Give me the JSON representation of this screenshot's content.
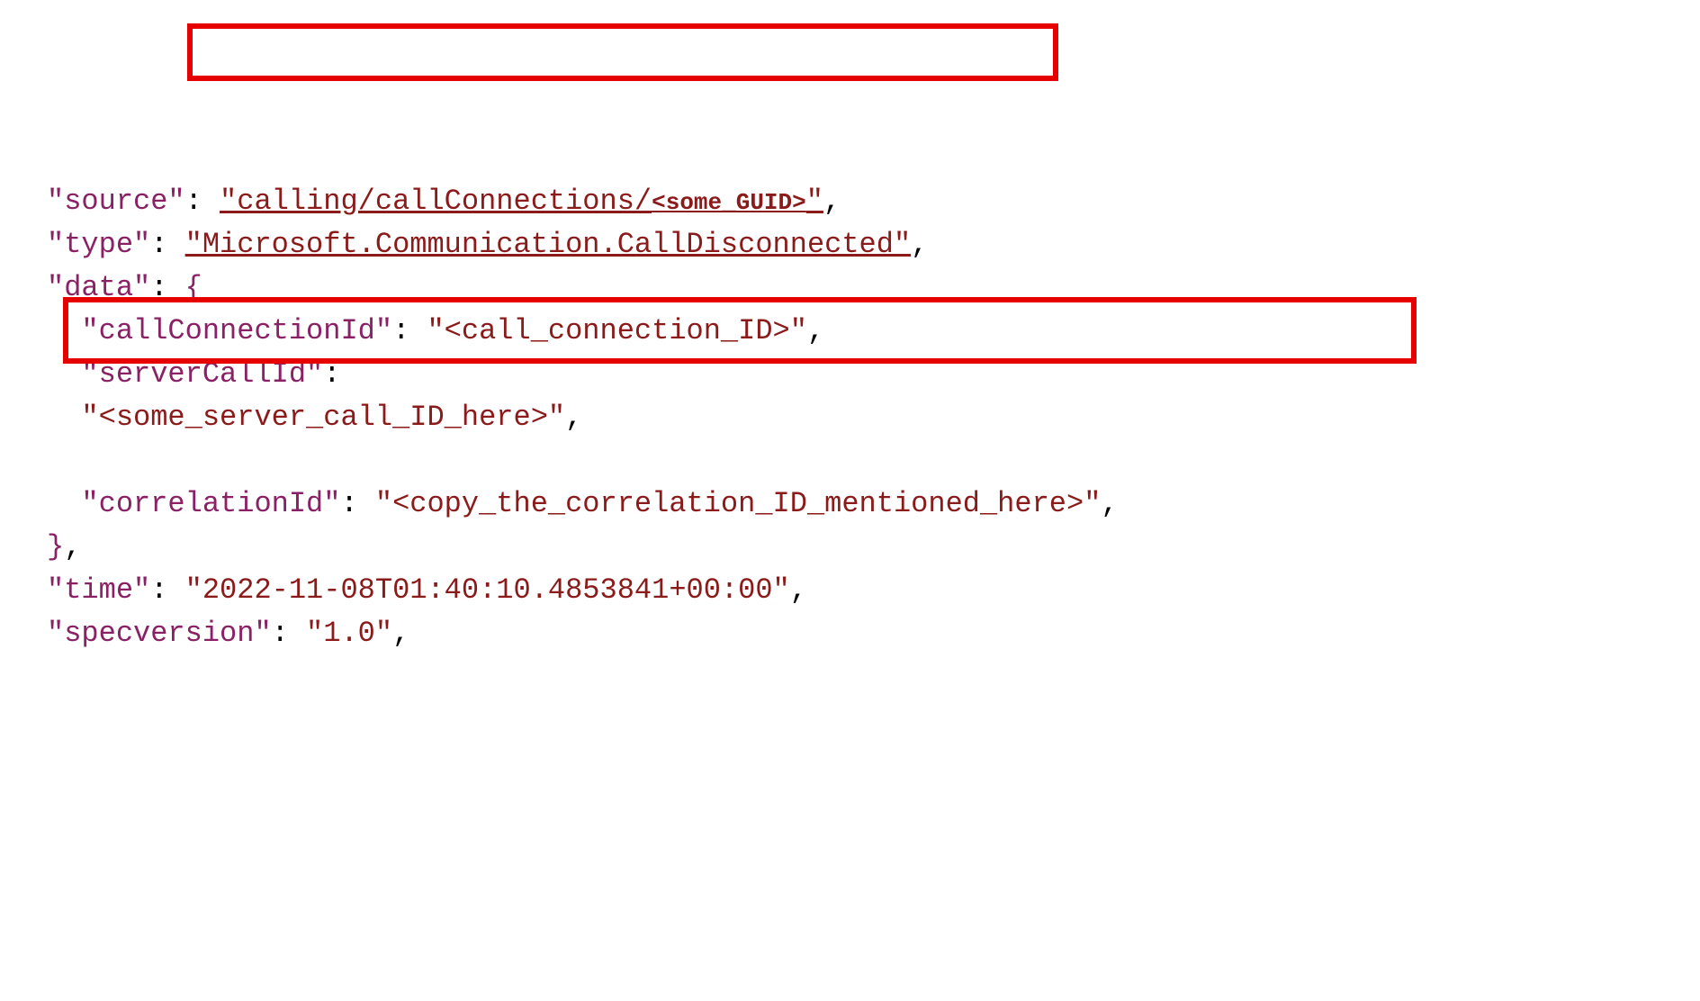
{
  "lines": {
    "source_key": "\"source\"",
    "source_val_prefix": "\"calling/callConnections/",
    "source_val_placeholder": "<some_GUID>",
    "source_val_suffix": "\"",
    "type_key": "\"type\"",
    "type_val": "\"Microsoft.Communication.CallDisconnected\"",
    "data_key": "\"data\"",
    "callConnId_key": "\"callConnectionId\"",
    "callConnId_val": "\"<call_connection_ID>\"",
    "serverCallId_key": "\"serverCallId\"",
    "serverCallId_val": "\"<some_server_call_ID_here>\"",
    "correlationId_key": "\"correlationId\"",
    "correlationId_val": "\"<copy_the_correlation_ID_mentioned_here>\"",
    "time_key": "\"time\"",
    "time_val": "\"2022-11-08T01:40:10.4853841+00:00\"",
    "specversion_key": "\"specversion\"",
    "specversion_val": "\"1.0\""
  }
}
